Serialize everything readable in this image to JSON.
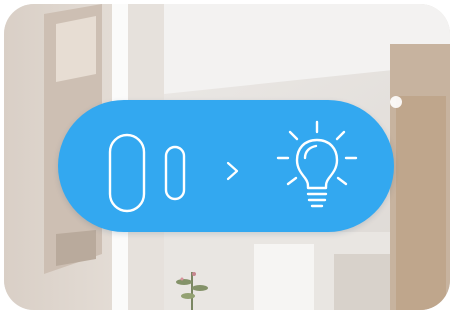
{
  "scene": {
    "description_label": ""
  },
  "automation": {
    "trigger_icon": "door-window-sensor-icon",
    "separator_icon": "chevron-right-icon",
    "action_icon": "light-bulb-icon",
    "pill_color": "#33a8f0",
    "icon_color": "#ffffff"
  }
}
